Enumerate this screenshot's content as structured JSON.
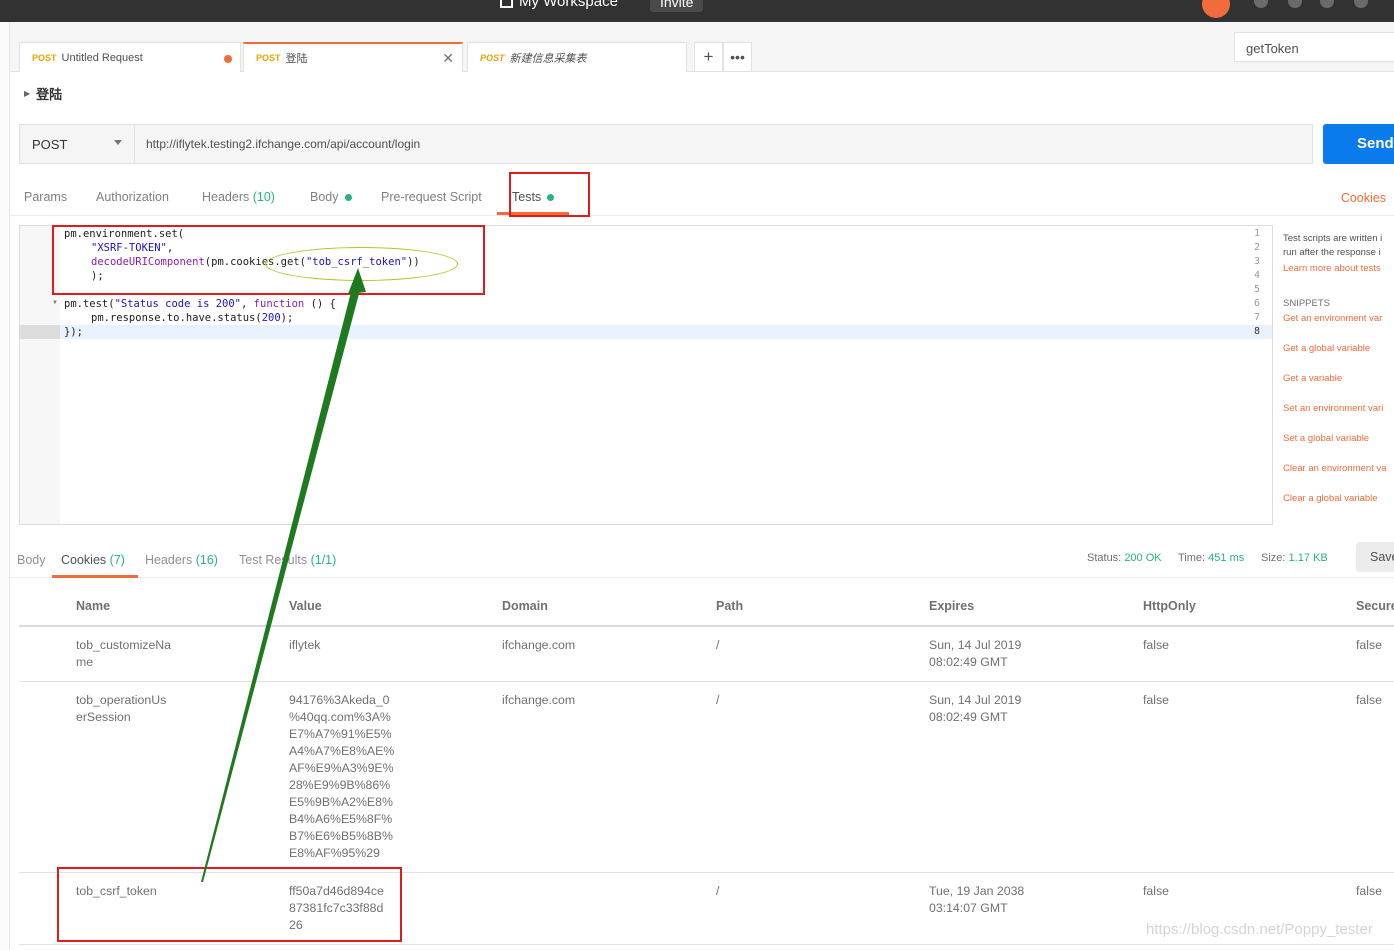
{
  "topbar": {
    "workspace": "My Workspace",
    "invite": "Invite"
  },
  "tabs": [
    {
      "method": "POST",
      "name": "Untitled Request"
    },
    {
      "method": "POST",
      "name": "登陆"
    },
    {
      "method": "POST",
      "name": "新建信息采集表"
    }
  ],
  "environment": {
    "selected": "getToken"
  },
  "breadcrumb": {
    "name": "登陆"
  },
  "request": {
    "method": "POST",
    "url": "http://iflytek.testing2.ifchange.com/api/account/login",
    "send_label": "Send"
  },
  "request_tabs": {
    "params": "Params",
    "authorization": "Authorization",
    "headers": "Headers",
    "headers_count": "(10)",
    "body": "Body",
    "prerequest": "Pre-request Script",
    "tests": "Tests",
    "cookies": "Cookies"
  },
  "editor": {
    "line_numbers": [
      "1",
      "2",
      "3",
      "4",
      "5",
      "6",
      "7",
      "8"
    ],
    "lines": {
      "l1": "pm.environment.set(",
      "l2": "\"XSRF-TOKEN\"",
      "l2b": ",",
      "l3a": "decodeURIComponent",
      "l3b": "(pm.cookies.get(",
      "l3c": "\"tob_csrf_token\"",
      "l3d": "))",
      "l4": ");",
      "l6a": "pm.test(",
      "l6b": "\"Status code is 200\"",
      "l6c": ", ",
      "l6d": "function",
      "l6e": " () {",
      "l7a": "pm.response.to.have.status(",
      "l7b": "200",
      "l7c": ");",
      "l8": "});"
    }
  },
  "sidebar": {
    "desc1": "Test scripts are written i",
    "desc2": "run after the response i",
    "learn_more": "Learn more about tests",
    "snippets_title": "SNIPPETS",
    "snippets": [
      "Get an environment var",
      "Get a global variable",
      "Get a variable",
      "Set an environment vari",
      "Set a global variable",
      "Clear an environment va",
      "Clear a global variable"
    ]
  },
  "response_tabs": {
    "body": "Body",
    "cookies": "Cookies",
    "cookies_count": "(7)",
    "headers": "Headers",
    "headers_count": "(16)",
    "test_results": "Test Results",
    "test_results_count": "(1/1)"
  },
  "response_status": {
    "status_label": "Status:",
    "status_value": "200 OK",
    "time_label": "Time:",
    "time_value": "451 ms",
    "size_label": "Size:",
    "size_value": "1.17 KB",
    "save_label": "Save"
  },
  "cookie_table": {
    "columns": [
      "Name",
      "Value",
      "Domain",
      "Path",
      "Expires",
      "HttpOnly",
      "Secure"
    ],
    "rows": [
      {
        "name": "tob_customizeNa\nme",
        "value": "iflytek",
        "domain": "ifchange.com",
        "path": "/",
        "expires": "Sun, 14 Jul 2019\n08:02:49 GMT",
        "httponly": "false",
        "secure": "false"
      },
      {
        "name": "tob_operationUs\nerSession",
        "value": "94176%3Akeda_0\n%40qq.com%3A%\nE7%A7%91%E5%\nA4%A7%E8%AE%\nAF%E9%A3%9E%\n28%E9%9B%86%\nE5%9B%A2%E8%\nB4%A6%E5%8F%\nB7%E6%B5%8B%\nE8%AF%95%29",
        "domain": "ifchange.com",
        "path": "/",
        "expires": "Sun, 14 Jul 2019\n08:02:49 GMT",
        "httponly": "false",
        "secure": "false"
      },
      {
        "name": "tob_csrf_token",
        "value": "ff50a7d46d894ce\n87381fc7c33f88d\n26",
        "domain": "",
        "path": "/",
        "expires": "Tue, 19 Jan 2038\n03:14:07 GMT",
        "httponly": "false",
        "secure": "false"
      }
    ]
  },
  "watermark": "https://blog.csdn.net/Poppy_tester",
  "colors": {
    "accent": "#f26b3a",
    "send": "#097bed",
    "success": "#26b47f",
    "annotation_red": "#e21c1c",
    "annotation_arrow": "#1f7a1f"
  }
}
